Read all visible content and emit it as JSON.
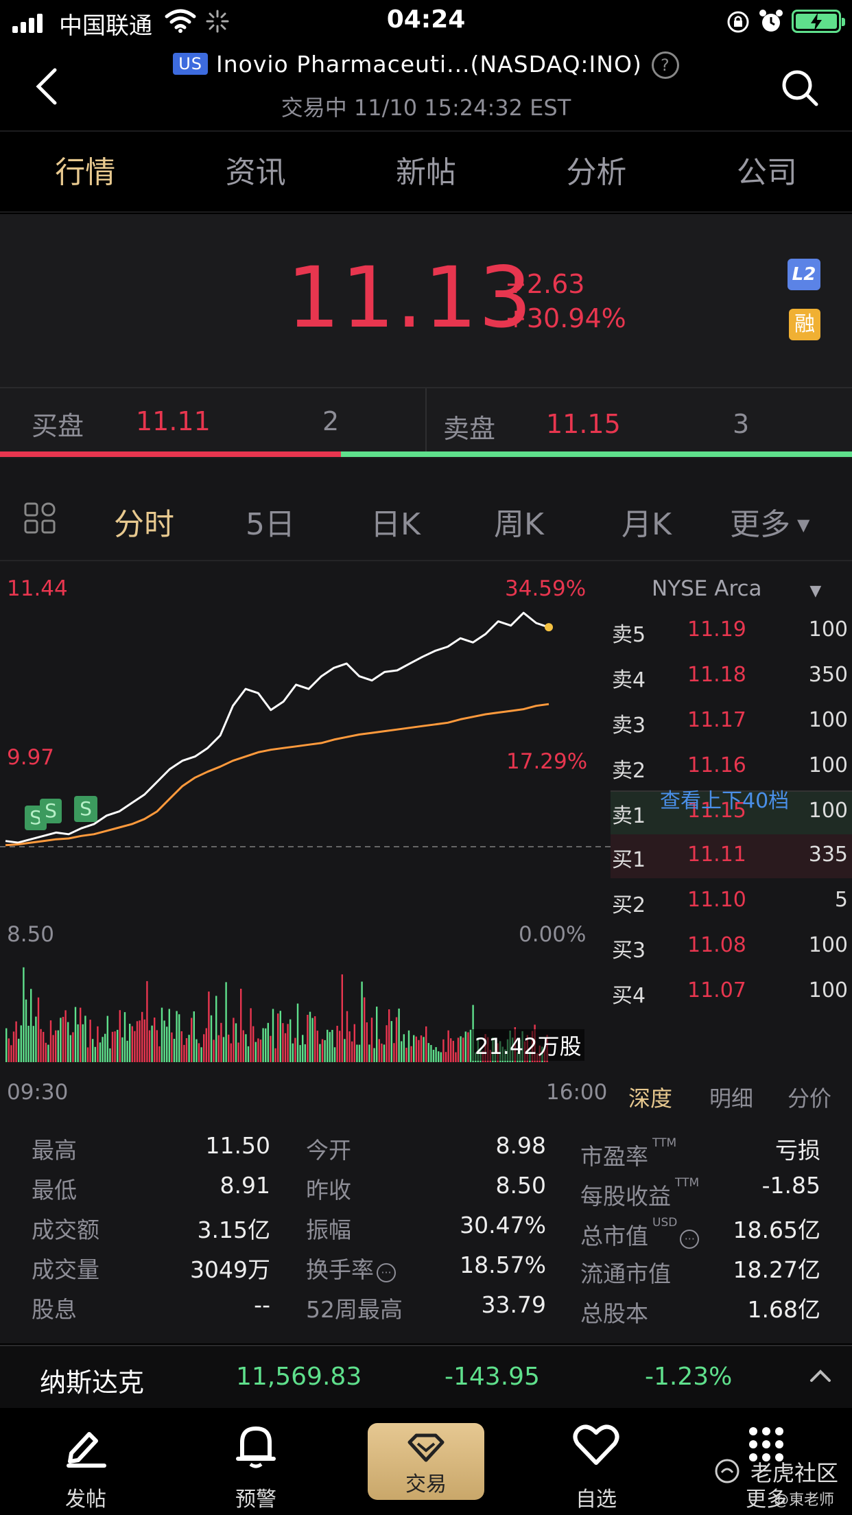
{
  "status": {
    "carrier": "中国联通",
    "time": "04:24"
  },
  "header": {
    "market_badge": "US",
    "title": "Inovio Pharmaceuti...(NASDAQ:INO)",
    "subtitle": "交易中 11/10 15:24:32 EST"
  },
  "tabs": [
    "行情",
    "资讯",
    "新帖",
    "分析",
    "公司"
  ],
  "quote": {
    "price": "11.13",
    "change": "+2.63",
    "change_pct": "+30.94%",
    "badge_l2": "L2",
    "badge_rong": "融"
  },
  "bidask": {
    "bid_label": "买盘",
    "bid_price": "11.11",
    "bid_size": "2",
    "ask_label": "卖盘",
    "ask_price": "11.15",
    "ask_size": "3",
    "bid_fraction": 0.4
  },
  "period_tabs": [
    "分时",
    "5日",
    "日K",
    "周K",
    "月K",
    "更多"
  ],
  "chart": {
    "y_high": "11.44",
    "y_high_pct": "34.59%",
    "y_mid": "9.97",
    "y_mid_pct": "17.29%",
    "y_low": "8.50",
    "y_low_pct": "0.00%",
    "volume_label": "21.42万股",
    "t_start": "09:30",
    "t_end": "16:00"
  },
  "chart_data": {
    "type": "line",
    "x_range": [
      "09:30",
      "16:00"
    ],
    "ylim": [
      8.5,
      11.44
    ],
    "prev_close": 8.5,
    "series": [
      {
        "values": [
          8.6,
          8.58,
          8.62,
          8.66,
          8.7,
          8.68,
          8.75,
          8.8,
          8.9,
          8.95,
          9.05,
          9.15,
          9.3,
          9.45,
          9.55,
          9.6,
          9.7,
          9.85,
          10.2,
          10.4,
          10.35,
          10.15,
          10.25,
          10.45,
          10.4,
          10.55,
          10.65,
          10.7,
          10.55,
          10.5,
          10.6,
          10.62,
          10.7,
          10.78,
          10.85,
          10.9,
          11.0,
          10.95,
          11.05,
          11.2,
          11.15,
          11.3,
          11.18,
          11.13
        ]
      },
      {
        "values": [
          8.55,
          8.56,
          8.58,
          8.6,
          8.62,
          8.63,
          8.66,
          8.68,
          8.72,
          8.76,
          8.8,
          8.86,
          8.95,
          9.1,
          9.25,
          9.35,
          9.42,
          9.48,
          9.55,
          9.6,
          9.65,
          9.68,
          9.7,
          9.72,
          9.74,
          9.76,
          9.8,
          9.83,
          9.86,
          9.88,
          9.9,
          9.92,
          9.94,
          9.96,
          9.98,
          10.0,
          10.04,
          10.07,
          10.1,
          10.12,
          10.14,
          10.16,
          10.2,
          10.22
        ]
      }
    ]
  },
  "orderbook": {
    "exchange": "NYSE Arca",
    "asks": [
      {
        "label": "卖5",
        "price": "11.19",
        "size": "100"
      },
      {
        "label": "卖4",
        "price": "11.18",
        "size": "350"
      },
      {
        "label": "卖3",
        "price": "11.17",
        "size": "100"
      },
      {
        "label": "卖2",
        "price": "11.16",
        "size": "100"
      },
      {
        "label": "卖1",
        "price": "11.15",
        "size": "100"
      }
    ],
    "more_link": "查看上下40档",
    "bids": [
      {
        "label": "买1",
        "price": "11.11",
        "size": "335"
      },
      {
        "label": "买2",
        "price": "11.10",
        "size": "5"
      },
      {
        "label": "买3",
        "price": "11.08",
        "size": "100"
      },
      {
        "label": "买4",
        "price": "11.07",
        "size": "100"
      }
    ],
    "subtabs": [
      "深度",
      "明细",
      "分价"
    ]
  },
  "stats": {
    "col1": [
      {
        "label": "最高",
        "value": "11.50"
      },
      {
        "label": "最低",
        "value": "8.91"
      },
      {
        "label": "成交额",
        "value": "3.15亿"
      },
      {
        "label": "成交量",
        "value": "3049万"
      },
      {
        "label": "股息",
        "value": "--"
      }
    ],
    "col2": [
      {
        "label": "今开",
        "value": "8.98"
      },
      {
        "label": "昨收",
        "value": "8.50"
      },
      {
        "label": "振幅",
        "value": "30.47%"
      },
      {
        "label": "换手率",
        "value": "18.57%"
      },
      {
        "label": "52周最高",
        "value": "33.79"
      }
    ],
    "col3": [
      {
        "label": "市盈率",
        "sup": "TTM",
        "value": "亏损"
      },
      {
        "label": "每股收益",
        "sup": "TTM",
        "value": "-1.85"
      },
      {
        "label": "总市值",
        "sup": "USD",
        "value": "18.65亿"
      },
      {
        "label": "流通市值",
        "value": "18.27亿"
      },
      {
        "label": "总股本",
        "value": "1.68亿"
      }
    ]
  },
  "index_bar": {
    "name": "纳斯达克",
    "value": "11,569.83",
    "change": "-143.95",
    "pct": "-1.23%"
  },
  "bottom_nav": [
    "发帖",
    "预警",
    "交易",
    "自选",
    "更多"
  ],
  "watermark": {
    "brand": "老虎社区",
    "author": "@東老师"
  }
}
